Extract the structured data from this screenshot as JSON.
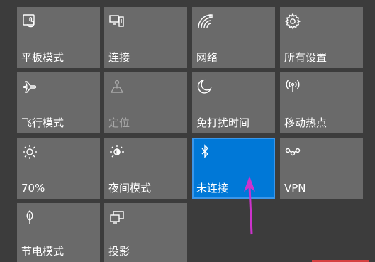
{
  "tiles": [
    {
      "name": "tile-tablet-mode",
      "label": "平板模式",
      "icon": "tablet-icon",
      "state": "off"
    },
    {
      "name": "tile-connect",
      "label": "连接",
      "icon": "cast-icon",
      "state": "off"
    },
    {
      "name": "tile-network",
      "label": "网络",
      "icon": "wifi-icon",
      "state": "off"
    },
    {
      "name": "tile-all-settings",
      "label": "所有设置",
      "icon": "gear-icon",
      "state": "off"
    },
    {
      "name": "tile-airplane-mode",
      "label": "飞行模式",
      "icon": "airplane-icon",
      "state": "off"
    },
    {
      "name": "tile-location",
      "label": "定位",
      "icon": "location-icon",
      "state": "disabled"
    },
    {
      "name": "tile-focus-assist",
      "label": "免打扰时间",
      "icon": "moon-icon",
      "state": "off"
    },
    {
      "name": "tile-mobile-hotspot",
      "label": "移动热点",
      "icon": "hotspot-icon",
      "state": "off"
    },
    {
      "name": "tile-brightness",
      "label": "70%",
      "icon": "brightness-icon",
      "state": "off"
    },
    {
      "name": "tile-night-light",
      "label": "夜间模式",
      "icon": "night-light-icon",
      "state": "off"
    },
    {
      "name": "tile-bluetooth",
      "label": "未连接",
      "icon": "bluetooth-icon",
      "state": "on"
    },
    {
      "name": "tile-vpn",
      "label": "VPN",
      "icon": "vpn-icon",
      "state": "off"
    },
    {
      "name": "tile-battery-saver",
      "label": "节电模式",
      "icon": "battery-saver-icon",
      "state": "off"
    },
    {
      "name": "tile-project",
      "label": "投影",
      "icon": "project-icon",
      "state": "off"
    }
  ],
  "colors": {
    "tile": "#6a6a6a",
    "active": "#0078d7",
    "annotation_arrow": "#cc33cc"
  }
}
